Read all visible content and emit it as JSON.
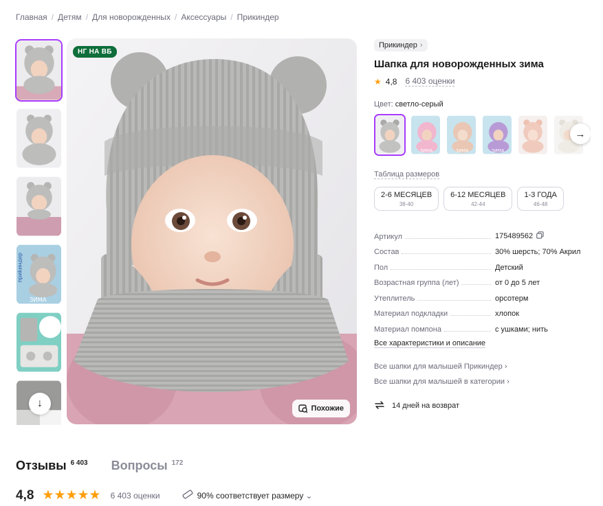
{
  "breadcrumb": [
    "Главная",
    "Детям",
    "Для новорожденных",
    "Аксессуары",
    "Прикиндер"
  ],
  "thumbnails": [
    {
      "kind": "photo",
      "active": true
    },
    {
      "kind": "photo"
    },
    {
      "kind": "photo"
    },
    {
      "kind": "brand",
      "brand_text": "приkиндер",
      "bottom_text": "ЗИМА"
    },
    {
      "kind": "infographic"
    },
    {
      "kind": "infographic-scroll"
    }
  ],
  "main_photo": {
    "badge": "НГ НА ВБ",
    "similar_button": "Похожие"
  },
  "product": {
    "brand": "Прикиндер",
    "title": "Шапка для новорожденных зима",
    "rating": "4,8",
    "reviews_link": "6 403 оценки",
    "color_label": "Цвет:",
    "color_value": "светло-серый",
    "size_table_link": "Таблица размеров",
    "sizes": [
      {
        "label": "2-6 МЕСЯЦЕВ",
        "sub": "38-40"
      },
      {
        "label": "6-12 МЕСЯЦЕВ",
        "sub": "42-44"
      },
      {
        "label": "1-3 ГОДА",
        "sub": "46-48"
      }
    ],
    "specs": [
      {
        "key": "Артикул",
        "value": "175489562",
        "copy": true
      },
      {
        "key": "Состав",
        "value": "30% шерсть; 70% Акрил"
      },
      {
        "key": "Пол",
        "value": "Детский"
      },
      {
        "key": "Возрастная группа (лет)",
        "value": "от 0 до 5 лет"
      },
      {
        "key": "Утеплитель",
        "value": "орсотерм"
      },
      {
        "key": "Материал подкладки",
        "value": "хлопок"
      },
      {
        "key": "Материал помпона",
        "value": "с ушками; нить"
      }
    ],
    "all_characteristics": "Все характеристики и описание",
    "link_brand": "Все шапки для малышей Прикиндер",
    "link_category": "Все шапки для малышей в категории",
    "return_text": "14 дней на возврат"
  },
  "swatches": [
    {
      "color": "#c9c9c7",
      "active": true
    },
    {
      "color": "#f2b6cf",
      "label": "ЗИМА"
    },
    {
      "color": "#e9c7b4",
      "label": "ЗИМА"
    },
    {
      "color": "#b89ad6",
      "label": "ЗИМА"
    },
    {
      "color": "#f0cbbd"
    },
    {
      "color": "#efece6"
    }
  ],
  "tabs": {
    "reviews": "Отзывы",
    "reviews_count": "6 403",
    "questions": "Вопросы",
    "questions_count": "172"
  },
  "bottom": {
    "score": "4,8",
    "stars": "★★★★★",
    "reviews": "6 403 оценки",
    "fit": "90% соответствует размеру"
  },
  "colors": {
    "accent": "#a73afd",
    "star": "#ff9e0d",
    "badge": "#0f6e3b"
  }
}
